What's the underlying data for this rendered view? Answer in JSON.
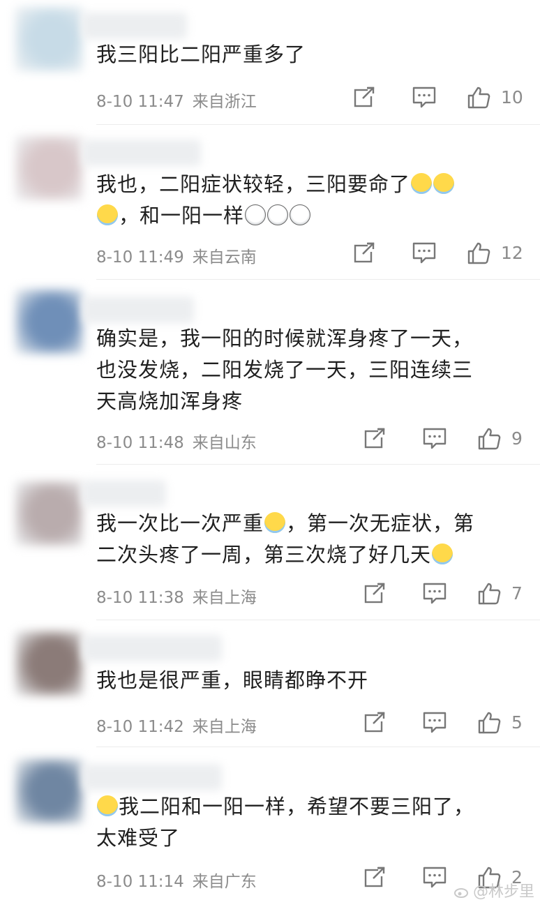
{
  "comments": [
    {
      "lines": [
        [
          {
            "t": "我三阳比二阳严重多了"
          }
        ]
      ],
      "date": "8-10 11:47",
      "region": "来自浙江",
      "likes": "10",
      "avatar_color": "#c7dbe7"
    },
    {
      "lines": [
        [
          {
            "t": "我也，二阳症状较轻，三阳要命了"
          },
          {
            "e": "cry-icon"
          },
          {
            "e": "cry-icon"
          }
        ],
        [
          {
            "e": "cry-icon"
          },
          {
            "t": "，和一阳一样"
          },
          {
            "e": "shocked-face-icon"
          },
          {
            "e": "shocked-face-icon"
          },
          {
            "e": "shocked-face-icon"
          }
        ]
      ],
      "date": "8-10 11:49",
      "region": "来自云南",
      "likes": "12",
      "avatar_color": "#d8c7c9"
    },
    {
      "lines": [
        [
          {
            "t": "确实是，我一阳的时候就浑身疼了一天，"
          }
        ],
        [
          {
            "t": "也没发烧，二阳发烧了一天，三阳连续三"
          }
        ],
        [
          {
            "t": "天高烧加浑身疼"
          }
        ]
      ],
      "date": "8-10 11:48",
      "region": "来自山东",
      "likes": "9",
      "avatar_color": "#6f8fb8"
    },
    {
      "lines": [
        [
          {
            "t": "我一次比一次严重"
          },
          {
            "e": "cry-icon"
          },
          {
            "t": "，第一次无症状，第"
          }
        ],
        [
          {
            "t": "二次头疼了一周，第三次烧了好几天"
          },
          {
            "e": "cry-icon"
          }
        ]
      ],
      "date": "8-10 11:38",
      "region": "来自上海",
      "likes": "7",
      "avatar_color": "#b9acad"
    },
    {
      "lines": [
        [
          {
            "t": "我也是很严重，眼睛都睁不开"
          }
        ]
      ],
      "date": "8-10 11:42",
      "region": "来自上海",
      "likes": "5",
      "avatar_color": "#8b7b78"
    },
    {
      "lines": [
        [
          {
            "e": "cry-icon"
          },
          {
            "t": "我二阳和一阳一样，希望不要三阳了，"
          }
        ],
        [
          {
            "t": "太难受了"
          }
        ]
      ],
      "date": "8-10 11:14",
      "region": "来自广东",
      "likes": "2",
      "avatar_color": "#6f86a2"
    }
  ],
  "watermark": "@林步里",
  "colors": {
    "meta_text": "#8b8b8b",
    "icon_stroke": "#777777",
    "divider": "#ececec"
  }
}
